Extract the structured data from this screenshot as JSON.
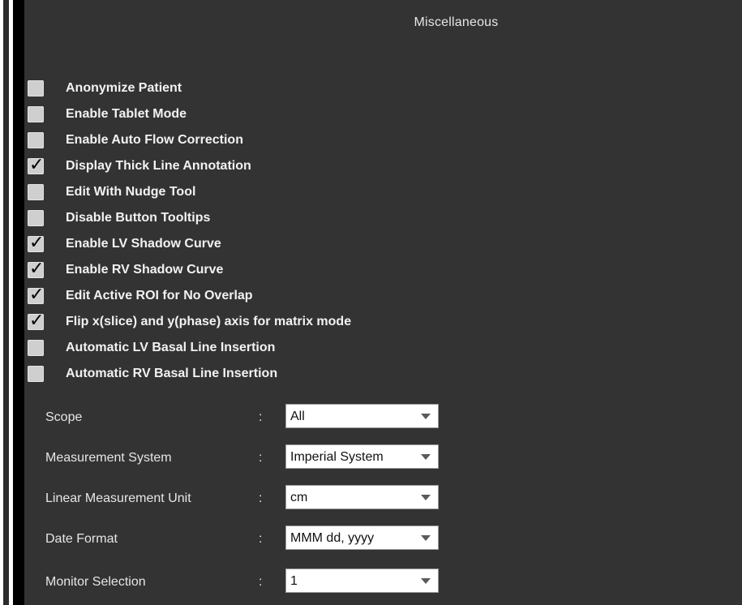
{
  "panel": {
    "title": "Miscellaneous"
  },
  "checkboxes": [
    {
      "label": "Anonymize Patient",
      "checked": false
    },
    {
      "label": "Enable Tablet Mode",
      "checked": false
    },
    {
      "label": "Enable Auto Flow Correction",
      "checked": false
    },
    {
      "label": "Display Thick Line Annotation",
      "checked": true
    },
    {
      "label": "Edit With Nudge Tool",
      "checked": false
    },
    {
      "label": "Disable Button Tooltips",
      "checked": false
    },
    {
      "label": "Enable LV Shadow Curve",
      "checked": true
    },
    {
      "label": "Enable RV Shadow Curve",
      "checked": true
    },
    {
      "label": "Edit Active ROI for No Overlap",
      "checked": true
    },
    {
      "label": "Flip x(slice) and y(phase) axis for matrix mode",
      "checked": true
    },
    {
      "label": "Automatic LV Basal Line Insertion",
      "checked": false
    },
    {
      "label": "Automatic RV Basal Line Insertion",
      "checked": false
    }
  ],
  "check_glyph": "✓",
  "form": {
    "colon": ":",
    "rows": [
      {
        "label": "Scope",
        "value": "All"
      },
      {
        "label": "Measurement System",
        "value": "Imperial System"
      },
      {
        "label": "Linear Measurement Unit",
        "value": "cm"
      },
      {
        "label": "Date Format",
        "value": "MMM dd, yyyy"
      },
      {
        "label": "Monitor Selection",
        "value": "1"
      }
    ]
  },
  "icons": {
    "checkbox_checked": "check-mark-icon",
    "dropdown_arrow": "chevron-down-icon"
  },
  "colors": {
    "panel_background": "#333333",
    "text": "#f2f2f2",
    "checkbox": "#cfcfcf",
    "dropdown_background": "#ffffff"
  }
}
